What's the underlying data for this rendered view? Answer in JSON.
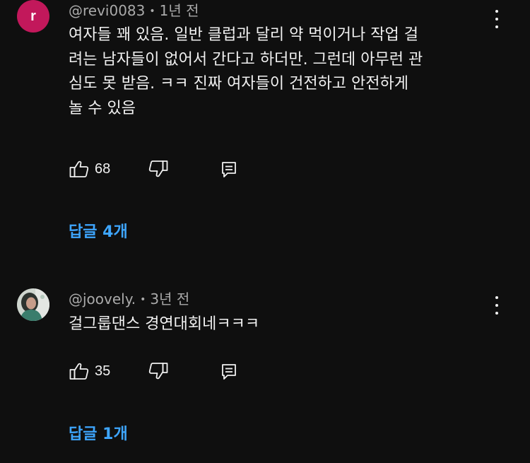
{
  "comments": [
    {
      "avatar_letter": "r",
      "avatar_color": "#c2185b",
      "handle": "@revi0083",
      "separator": "•",
      "time": "1년 전",
      "lines": [
        "여자들 꽤 있음. 일반 클럽과 달리 약 먹이거나 작업 걸",
        "려는 남자들이 없어서 간다고 하더만. 그런데 아무런 관",
        "심도 못 받음. ㅋㅋ 진짜 여자들이 건전하고 안전하게",
        "놀 수 있음"
      ],
      "likes": "68",
      "replies_label": "답글 4개"
    },
    {
      "handle": "@joovely.",
      "separator": "•",
      "time": "3년 전",
      "lines": [
        "걸그룹댄스 경연대회네ㅋㅋㅋ"
      ],
      "likes": "35",
      "replies_label": "답글 1개"
    }
  ],
  "colors": {
    "background": "#0f0f0f",
    "text": "#f1f1f1",
    "meta": "#aaaaaa",
    "link": "#3ea6ff"
  },
  "icons": [
    "more-vert-icon",
    "thumb-up-icon",
    "thumb-down-icon",
    "reply-icon"
  ]
}
